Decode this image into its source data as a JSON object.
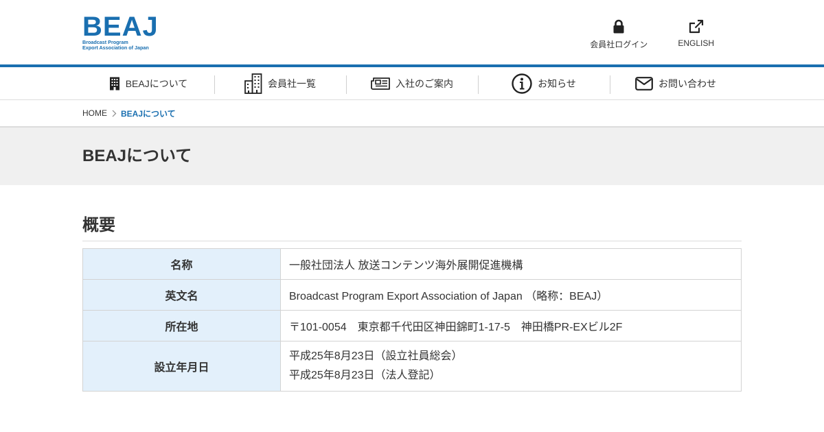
{
  "logo": {
    "main": "BEAJ",
    "sub_line1": "Broadcast Program",
    "sub_line2": "Export Association of Japan"
  },
  "header_links": [
    {
      "label": "会員社ログイン",
      "icon": "lock-icon"
    },
    {
      "label": "ENGLISH",
      "icon": "external-link-icon"
    }
  ],
  "nav": [
    {
      "label": "BEAJについて",
      "icon": "building-icon"
    },
    {
      "label": "会員社一覧",
      "icon": "office-building-icon"
    },
    {
      "label": "入社のご案内",
      "icon": "newspaper-icon"
    },
    {
      "label": "お知らせ",
      "icon": "info-icon"
    },
    {
      "label": "お問い合わせ",
      "icon": "envelope-icon"
    }
  ],
  "breadcrumb": {
    "home": "HOME",
    "current": "BEAJについて"
  },
  "page_title": "BEAJについて",
  "section": {
    "title": "概要",
    "rows": [
      {
        "label": "名称",
        "value": "一般社団法人 放送コンテンツ海外展開促進機構"
      },
      {
        "label": "英文名",
        "value": "Broadcast Program Export Association of Japan （略称：BEAJ）"
      },
      {
        "label": "所在地",
        "value": "〒101-0054　東京都千代田区神田錦町1-17-5　神田橋PR-EXビル2F"
      },
      {
        "label": "設立年月日",
        "value_line1": "平成25年8月23日（設立社員総会）",
        "value_line2": "平成25年8月23日（法人登記）"
      }
    ]
  },
  "colors": {
    "brand": "#1a6fb0",
    "th_background": "#e3f0fb",
    "band_background": "#f0f0f0"
  }
}
